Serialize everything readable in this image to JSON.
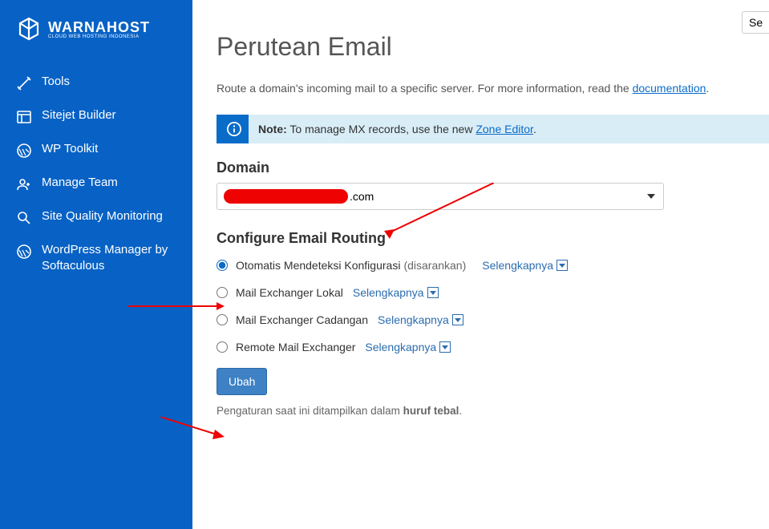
{
  "brand": {
    "name": "WARNAHOST",
    "tagline": "CLOUD WEB HOSTING INDONESIA"
  },
  "sidebar": {
    "items": [
      {
        "label": "Tools"
      },
      {
        "label": "Sitejet Builder"
      },
      {
        "label": "WP Toolkit"
      },
      {
        "label": "Manage Team"
      },
      {
        "label": "Site Quality Monitoring"
      },
      {
        "label": "WordPress Manager by Softaculous"
      }
    ]
  },
  "search": {
    "placeholder": "Se"
  },
  "page": {
    "title": "Perutean Email",
    "description_pre": "Route a domain's incoming mail to a specific server. For more information, read the ",
    "description_link": "documentation",
    "description_post": "."
  },
  "notice": {
    "label": "Note:",
    "text": " To manage MX records, use the new ",
    "link": "Zone Editor",
    "post": "."
  },
  "domain": {
    "label": "Domain",
    "suffix": ".com"
  },
  "config": {
    "title": "Configure Email Routing",
    "options": [
      {
        "label": "Otomatis Mendeteksi Konfigurasi",
        "hint": "(disarankan)",
        "more": "Selengkapnya"
      },
      {
        "label": "Mail Exchanger Lokal",
        "hint": "",
        "more": "Selengkapnya"
      },
      {
        "label": "Mail Exchanger Cadangan",
        "hint": "",
        "more": "Selengkapnya"
      },
      {
        "label": "Remote Mail Exchanger",
        "hint": "",
        "more": "Selengkapnya"
      }
    ],
    "submit": "Ubah",
    "note_pre": "Pengaturan saat ini ditampilkan dalam ",
    "note_bold": "huruf tebal",
    "note_post": "."
  }
}
